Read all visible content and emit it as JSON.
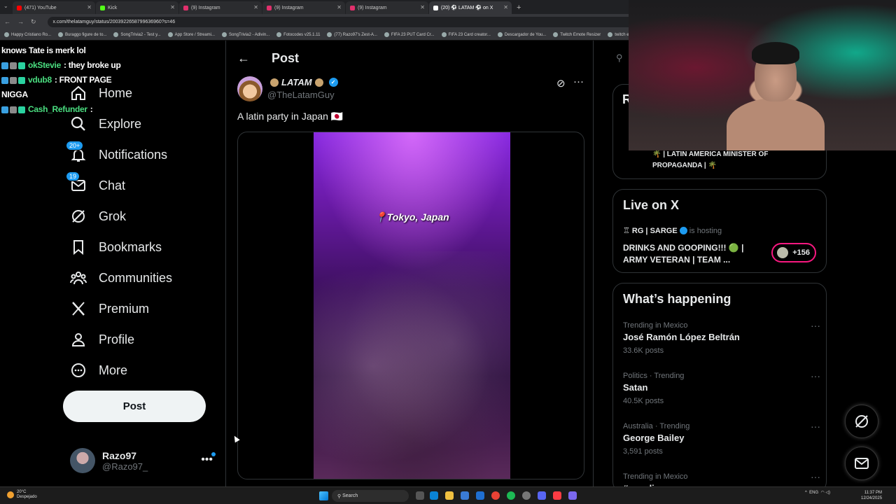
{
  "browser": {
    "tabs": [
      {
        "title": "(471) YouTube",
        "color": "#ff0000",
        "active": false
      },
      {
        "title": "Kick",
        "color": "#53fc18",
        "active": false
      },
      {
        "title": "(9) Instagram",
        "color": "#e1306c",
        "active": false
      },
      {
        "title": "(9) Instagram",
        "color": "#e1306c",
        "active": false
      },
      {
        "title": "(9) Instagram",
        "color": "#e1306c",
        "active": false
      },
      {
        "title": "(20) ⚽ LATAM ⚽ on X",
        "color": "#ffffff",
        "active": true
      }
    ],
    "new_tab": "+",
    "url": "x.com/thelatamguy/status/2003922658799636960?s=46",
    "bookmarks": [
      "Happy Cristiano Ro...",
      "Buraggo figure de to...",
      "SongTrivia2 - Test y...",
      "App Store / Streami...",
      "SongTrivia2 - Adivin...",
      "Fotocodes v25.1.11",
      "(77) Razo97's Zest-A...",
      "FIFA 23 PUT Card Cr...",
      "FIFA 23 Card creator...",
      "Descargador de You...",
      "Twitch Emote Resizer",
      "twitch em..."
    ]
  },
  "chat": [
    {
      "name": "",
      "name_color": "#ffffff",
      "message": "knows Tate is merk lol"
    },
    {
      "name": "okStevie",
      "name_color": "#4ade80",
      "message": ": they broke up"
    },
    {
      "name": "vdub8",
      "name_color": "#4ade80",
      "message": ": FRONT PAGE"
    },
    {
      "name": "",
      "name_color": "#ffffff",
      "message": "NIGGA"
    },
    {
      "name": "Cash_Refunder",
      "name_color": "#4ade80",
      "message": ":"
    }
  ],
  "nav": {
    "items": [
      {
        "label": "Home",
        "icon": "home-icon",
        "badge": ""
      },
      {
        "label": "Explore",
        "icon": "search-icon",
        "badge": ""
      },
      {
        "label": "Notifications",
        "icon": "bell-icon",
        "badge": "20+"
      },
      {
        "label": "Chat",
        "icon": "mail-icon",
        "badge": "19"
      },
      {
        "label": "Grok",
        "icon": "grok-icon",
        "badge": ""
      },
      {
        "label": "Bookmarks",
        "icon": "bookmark-icon",
        "badge": ""
      },
      {
        "label": "Communities",
        "icon": "communities-icon",
        "badge": ""
      },
      {
        "label": "Premium",
        "icon": "x-logo-icon",
        "badge": ""
      },
      {
        "label": "Profile",
        "icon": "person-icon",
        "badge": ""
      },
      {
        "label": "More",
        "icon": "more-circle-icon",
        "badge": ""
      }
    ],
    "post_button": "Post",
    "account": {
      "name": "Razo97",
      "handle": "@Razo97_",
      "more": "•••"
    }
  },
  "post": {
    "header": "Post",
    "back": "←",
    "author_name": "LATAM",
    "author_handle": "@TheLatamGuy",
    "verified_mark": "✓",
    "text": "A latin party in Japan 🇯🇵",
    "video_caption": "📍Tokyo, Japan",
    "more": "···"
  },
  "right": {
    "who_initial": "R",
    "who_bio": "🌴 | LATIN AMERICA MINISTER OF PROPAGANDA | 🌴",
    "live": {
      "title": "Live on X",
      "host_name": "RG | SARGE",
      "host_suffix": "is hosting",
      "space_title": "DRINKS AND GOOPING!!! 🟢 | ARMY VETERAN | TEAM ...",
      "listeners": "+156"
    },
    "trends_title": "What’s happening",
    "trends": [
      {
        "context": "Trending in Mexico",
        "name": "José Ramón López Beltrán",
        "count": "33.6K posts"
      },
      {
        "context": "Politics · Trending",
        "name": "Satan",
        "count": "40.5K posts"
      },
      {
        "context": "Australia · Trending",
        "name": "George Bailey",
        "count": "3,591 posts"
      },
      {
        "context": "Trending in Mexico",
        "name": "#gasolina",
        "count": ""
      }
    ],
    "trend_more": "···"
  },
  "taskbar": {
    "weather_temp": "20°C",
    "weather_desc": "Despejado",
    "search": "Search",
    "lang": "ENG",
    "time": "11:37 PM",
    "date": "12/24/2025"
  }
}
